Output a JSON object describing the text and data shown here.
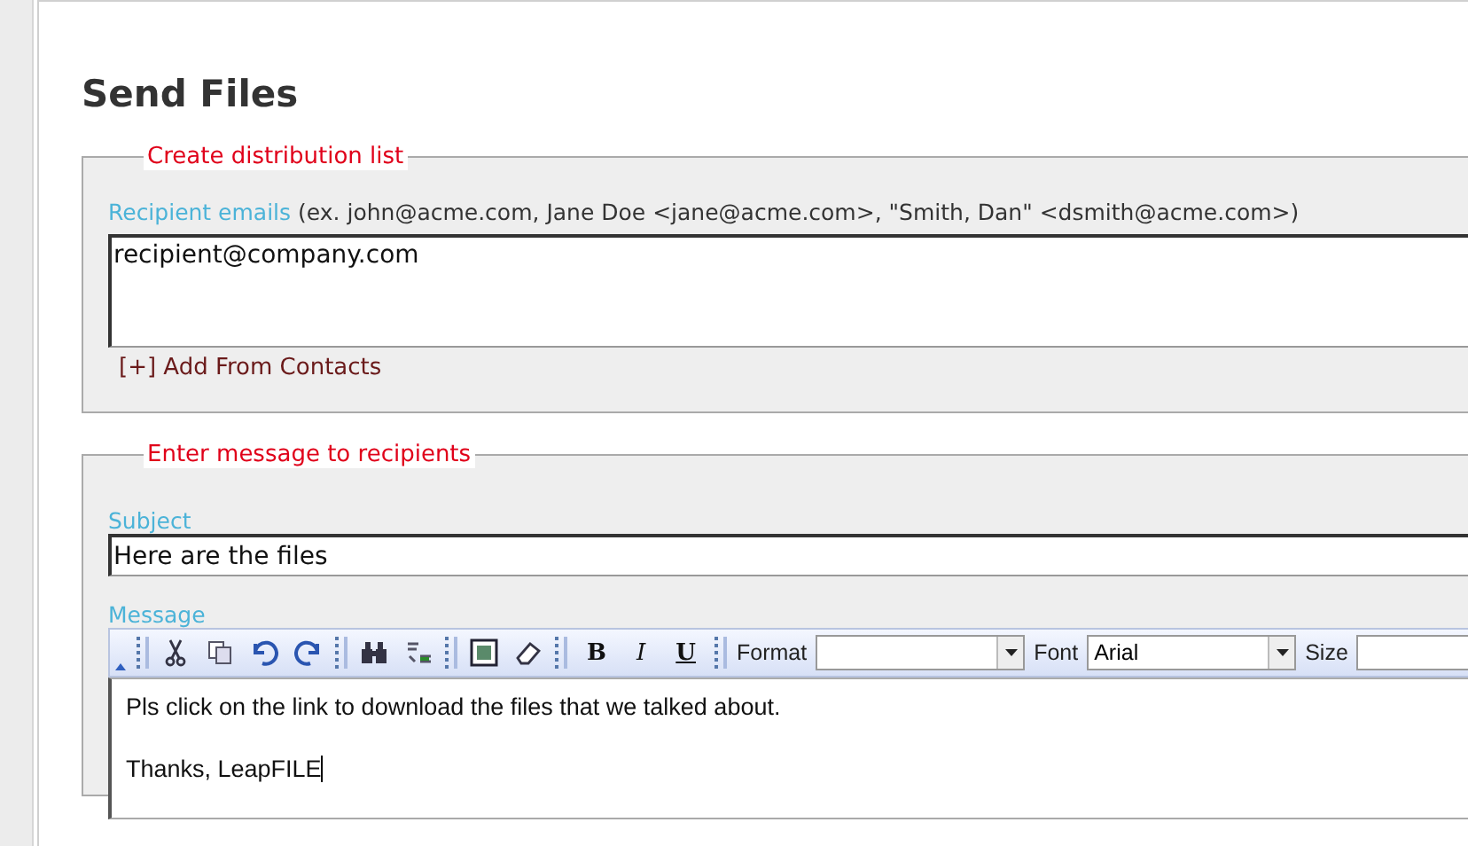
{
  "page": {
    "title": "Send Files"
  },
  "distribution": {
    "legend": "Create distribution list",
    "label": "Recipient emails",
    "hint": "(ex. john@acme.com, Jane Doe <jane@acme.com>, \"Smith, Dan\" <dsmith@acme.com>)",
    "value": "recipient@company.com",
    "add_link": "[+] Add From Contacts"
  },
  "message_section": {
    "legend": "Enter message to recipients",
    "subject_label": "Subject",
    "subject": "Here are the files",
    "message_label": "Message",
    "format_buttons": [
      {
        "label": "B",
        "kind": "bold"
      },
      {
        "label": "I",
        "kind": "italic"
      },
      {
        "label": "U",
        "kind": "underline"
      }
    ],
    "dropdowns": [
      {
        "label": "Format"
      },
      {
        "label": "Font",
        "value": "Arial"
      },
      {
        "label": "Size"
      }
    ],
    "body": [
      "Pls click on the link to download the files that we talked about.",
      "Thanks, LeapFILE"
    ]
  }
}
